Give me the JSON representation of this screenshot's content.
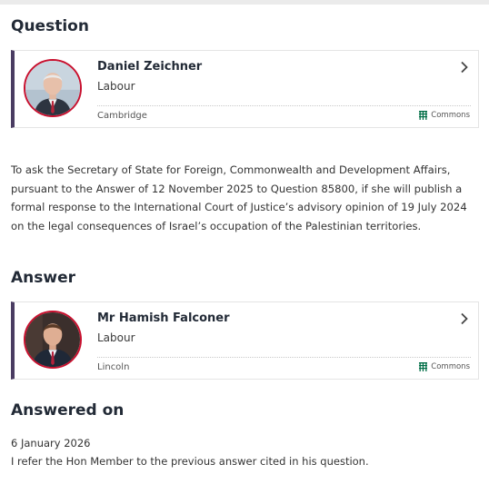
{
  "question": {
    "heading": "Question",
    "member": {
      "name": "Daniel Zeichner",
      "party": "Labour",
      "constituency": "Cambridge",
      "house": "Commons"
    },
    "text": "To ask the Secretary of State for Foreign, Commonwealth and Development Affairs, pursuant to the Answer of 12 November 2025 to Question 85800, if she will publish a formal response to the International Court of Justice’s advisory opinion of 19 July 2024 on the legal consequences of Israel’s occupation of the Palestinian territories."
  },
  "answer": {
    "heading": "Answer",
    "member": {
      "name": "Mr Hamish Falconer",
      "party": "Labour",
      "constituency": "Lincoln",
      "house": "Commons"
    }
  },
  "answered": {
    "heading": "Answered on",
    "date": "6 January 2026",
    "text": "I refer the Hon Member to the previous answer cited in his question."
  },
  "colors": {
    "party_accent": "#c8102e",
    "card_border_left": "#4a3c62",
    "commons_green": "#006e46"
  },
  "icons": {
    "chevron": "chevron-right-icon",
    "house": "portcullis-icon"
  }
}
